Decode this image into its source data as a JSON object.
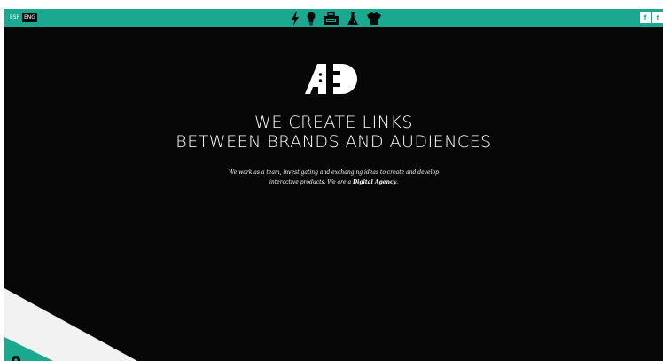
{
  "languages": {
    "esp": "ESP",
    "eng": "ENG"
  },
  "nav_icons": [
    "lightning-icon",
    "lightbulb-icon",
    "toolbox-icon",
    "flask-icon",
    "tshirt-icon"
  ],
  "social": {
    "facebook": "f",
    "twitter": "t"
  },
  "logo_text": "A:D",
  "hero": {
    "headline_line1": "WE CREATE LINKS",
    "headline_line2": "BETWEEN BRANDS AND AUDIENCES",
    "tagline_line1": "We work as a team, investigating and exchanging ideas to create and develop",
    "tagline_line2_prefix": "interactive products. We are a ",
    "tagline_line2_bold": "Digital Agency",
    "tagline_line2_suffix": "."
  },
  "colors": {
    "accent": "#1aa88f",
    "background": "#070707",
    "text": "#ffffff"
  }
}
